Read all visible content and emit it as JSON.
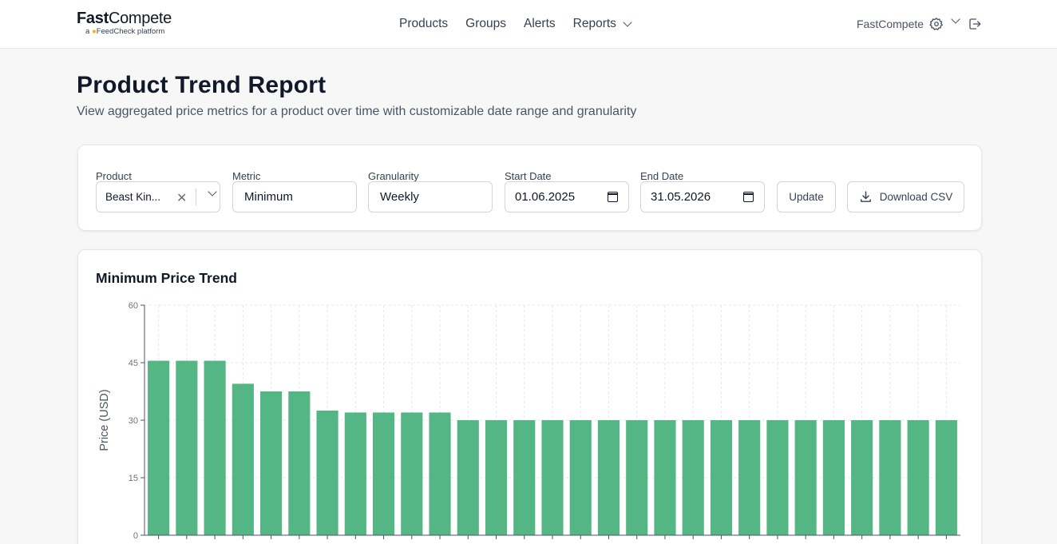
{
  "app": {
    "brand": "FastCompete",
    "brand_bold": "Fast",
    "brand_rest": "Compete",
    "tagline_prefix": "a",
    "tagline_brand": "FeedCheck",
    "tagline_suffix": "platform",
    "user_name": "FastCompete"
  },
  "nav": {
    "items": [
      {
        "label": "Products"
      },
      {
        "label": "Groups"
      },
      {
        "label": "Alerts"
      },
      {
        "label": "Reports"
      }
    ]
  },
  "page": {
    "title": "Product Trend Report",
    "subtitle": "View aggregated price metrics for a product over time with customizable date range and granularity"
  },
  "filters": {
    "product_label": "Product",
    "product_value": "Beast Kin...",
    "metric_label": "Metric",
    "metric_value": "Minimum",
    "granularity_label": "Granularity",
    "granularity_value": "Weekly",
    "start_label": "Start Date",
    "start_value": "01.06.2025",
    "end_label": "End Date",
    "end_value": "31.05.2026",
    "update_label": "Update",
    "download_label": "Download CSV"
  },
  "icons": {
    "settings": "gear-icon",
    "logout": "logout-icon",
    "clear": "close-icon",
    "dropdown": "chevron-down-icon",
    "calendar": "calendar-icon",
    "download": "download-icon"
  },
  "colors": {
    "bar": "#54b685",
    "grid": "#e5e7eb",
    "axis": "#4b5563",
    "text": "#111827"
  },
  "chart_data": {
    "type": "bar",
    "title": "Minimum Price Trend",
    "ylabel": "Price (USD)",
    "xlabel": "",
    "ylim": [
      0,
      60
    ],
    "yticks": [
      0,
      15,
      30,
      45,
      60
    ],
    "grid": true,
    "values": [
      45.5,
      45.5,
      45.5,
      39.5,
      37.5,
      37.5,
      32.5,
      32,
      32,
      32,
      32,
      30,
      30,
      30,
      30,
      30,
      30,
      30,
      30,
      30,
      30,
      30,
      30,
      30,
      30,
      30,
      30,
      30,
      30
    ]
  }
}
